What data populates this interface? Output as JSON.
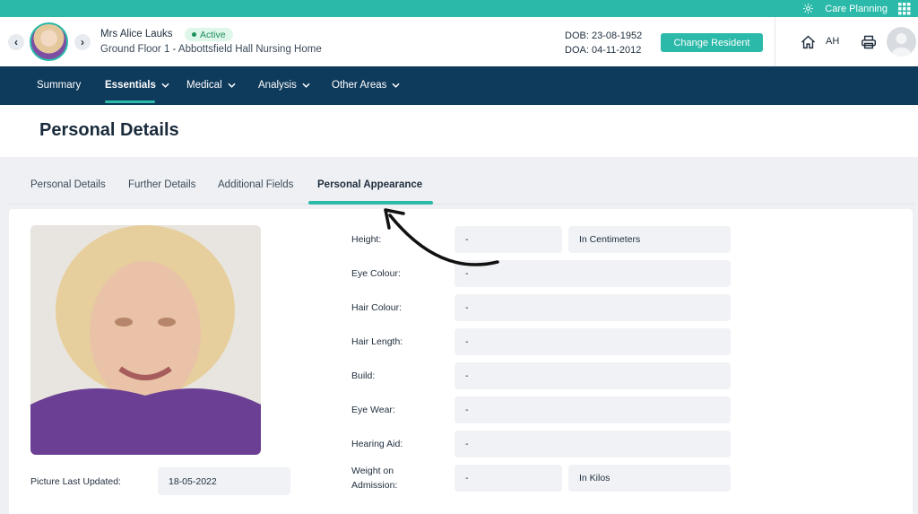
{
  "topbar": {
    "app_label": "Care Planning",
    "settings_icon": "gear-icon",
    "apps_icon": "grid-icon"
  },
  "resident": {
    "name": "Mrs Alice Lauks",
    "status": "Active",
    "location": "Ground Floor 1 - Abbottsfield Hall Nursing Home",
    "dob": "DOB: 23-08-1952",
    "doa": "DOA: 04-11-2012",
    "change_label": "Change Resident"
  },
  "user": {
    "initials": "AH"
  },
  "nav": {
    "items": [
      {
        "label": "Summary"
      },
      {
        "label": "Essentials"
      },
      {
        "label": "Medical"
      },
      {
        "label": "Analysis"
      },
      {
        "label": "Other Areas"
      }
    ],
    "active": "Essentials"
  },
  "page": {
    "title": "Personal Details"
  },
  "tabs": [
    {
      "label": "Personal Details"
    },
    {
      "label": "Further Details"
    },
    {
      "label": "Additional Fields"
    },
    {
      "label": "Personal Appearance"
    }
  ],
  "active_tab": "Personal Appearance",
  "picture": {
    "label": "Picture Last Updated:",
    "value": "18-05-2022"
  },
  "fields": {
    "height": {
      "label": "Height:",
      "value": "-",
      "unit": "In Centimeters"
    },
    "eye_colour": {
      "label": "Eye Colour:",
      "value": "-"
    },
    "hair_colour": {
      "label": "Hair Colour:",
      "value": "-"
    },
    "hair_length": {
      "label": "Hair Length:",
      "value": "-"
    },
    "build": {
      "label": "Build:",
      "value": "-"
    },
    "eye_wear": {
      "label": "Eye Wear:",
      "value": "-"
    },
    "hearing_aid": {
      "label": "Hearing Aid:",
      "value": "-"
    },
    "weight": {
      "label_line1": "Weight on",
      "label_line2": "Admission:",
      "value": "-",
      "unit": "In Kilos"
    }
  },
  "colors": {
    "accent": "#2bb9a9",
    "navbar": "#0e3a5c"
  }
}
